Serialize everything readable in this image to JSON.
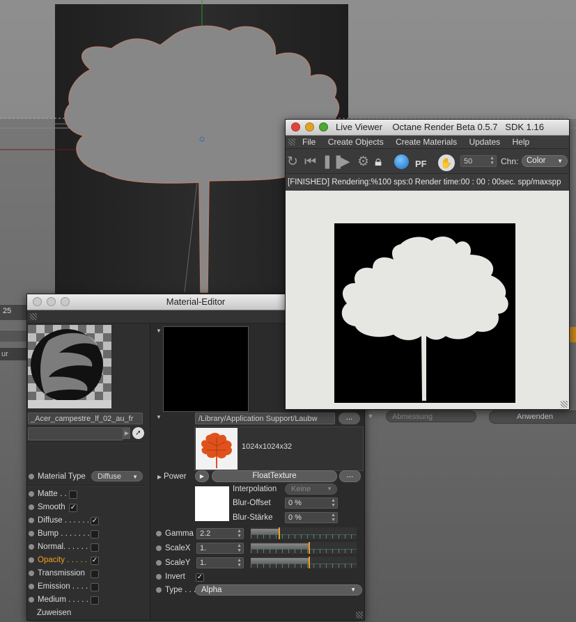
{
  "background": {
    "timeline_number": "25",
    "left_label": "ur",
    "dropdown_placeholder": "Abmessung",
    "apply_button": "Anwenden"
  },
  "material_editor": {
    "title": "Material-Editor",
    "material_name": "_Acer_campestre_lf_02_au_fr",
    "material_type_label": "Material Type",
    "material_type_value": "Diffuse",
    "channels": [
      {
        "label": "Matte . .",
        "checked": false
      },
      {
        "label": "Smooth",
        "checked": true
      },
      {
        "label": "Diffuse . . . . . .",
        "checked": true
      },
      {
        "label": "Bump . . . . . . .",
        "checked": false
      },
      {
        "label": "Normal. . . . . .",
        "checked": false
      },
      {
        "label": "Opacity . . . . .",
        "checked": true,
        "active": true
      },
      {
        "label": "Transmission",
        "checked": false
      },
      {
        "label": "Emission . . . .",
        "checked": false
      },
      {
        "label": "Medium . . . . .",
        "checked": false
      }
    ],
    "assign_label": "Zuweisen",
    "texture_path": "/Library/Application Support/Laubw",
    "ellipsis": "...",
    "texture_size": "1024x1024x32",
    "power_label": "Power",
    "power_value": "FloatTexture",
    "interpolation_label": "Interpolation",
    "interpolation_value": "Keine",
    "blur_offset_label": "Blur-Offset",
    "blur_offset_value": "0 %",
    "blur_strength_label": "Blur-Stärke",
    "blur_strength_value": "0 %",
    "gamma_label": "Gamma",
    "gamma_value": "2.2",
    "gamma_slider": 0.27,
    "scalex_label": "ScaleX",
    "scalex_value": "1.",
    "scalex_slider": 0.55,
    "scaley_label": "ScaleY",
    "scaley_value": "1.",
    "scaley_slider": 0.55,
    "invert_label": "Invert",
    "invert_checked": true,
    "type_label": "Type . . .",
    "type_value": "Alpha"
  },
  "live_viewer": {
    "title": "Live Viewer    Octane Render Beta 0.5.7   SDK 1.16",
    "menu": [
      "File",
      "Create Objects",
      "Create Materials",
      "Updates",
      "Help"
    ],
    "samples_value": "50",
    "channel_label": "Chn:",
    "channel_value": "Color",
    "status": "[FINISHED]  Rendering:%100 sps:0 Render time:00 : 00 : 00sec. spp/maxspp"
  },
  "colors": {
    "accent_orange": "#f0a020",
    "traffic_red": "#e0443a",
    "traffic_yellow": "#e0a424",
    "traffic_green": "#4ea832"
  }
}
